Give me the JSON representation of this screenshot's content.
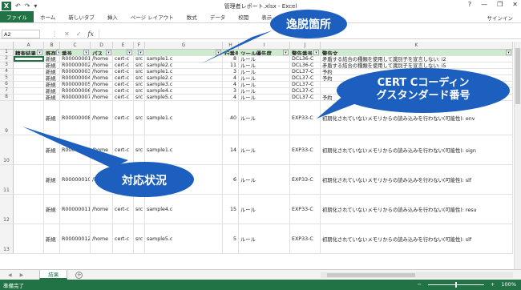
{
  "window": {
    "title": "管理者レポート.xlsx - Excel",
    "quick_access": [
      "↶",
      "↷",
      "▾"
    ],
    "controls": [
      "?",
      "—",
      "❐",
      "✕"
    ]
  },
  "ribbon": {
    "tabs": [
      "ファイル",
      "ホーム",
      "新しいタブ",
      "挿入",
      "ページ レイアウト",
      "数式",
      "データ",
      "校閲",
      "表示",
      "SkyPDF"
    ],
    "signin": "サインイン"
  },
  "formula_bar": {
    "name_box": "A2",
    "icons": [
      "⋮",
      "✕",
      "✓"
    ],
    "fx": "fx",
    "value": ""
  },
  "grid": {
    "columns": [
      "A",
      "B",
      "C",
      "D",
      "E",
      "F",
      "G",
      "H",
      "I",
      "J",
      "K"
    ],
    "headers": [
      "精査結果",
      "既存",
      "番号",
      "パス",
      "",
      "",
      "",
      "行番号",
      "ツール優先度",
      "警告番号",
      "警告文"
    ],
    "rows": [
      {
        "num": "2",
        "cells": [
          "",
          "新規",
          "R00000001",
          "/home",
          "cert-c",
          "src",
          "sample1.c",
          "8",
          "ルール",
          "DCL36-C",
          "矛盾する結合の種類を使用して識別子を宣言しない: i2"
        ]
      },
      {
        "num": "3",
        "cells": [
          "",
          "新規",
          "R00000002",
          "/home",
          "cert-c",
          "src",
          "sample2.c",
          "11",
          "ルール",
          "DCL36-C",
          "矛盾する結合の種類を使用して識別子を宣言しない: i5"
        ]
      },
      {
        "num": "4",
        "cells": [
          "",
          "新規",
          "R00000003",
          "/home",
          "cert-c",
          "src",
          "sample1.c",
          "3",
          "ルール",
          "DCL37-C",
          "予約"
        ]
      },
      {
        "num": "5",
        "cells": [
          "",
          "新規",
          "R00000004",
          "/home",
          "cert-c",
          "src",
          "sample2.c",
          "4",
          "ルール",
          "DCL37-C",
          "予約"
        ]
      },
      {
        "num": "6",
        "cells": [
          "",
          "新規",
          "R00000005",
          "/home",
          "cert-c",
          "src",
          "sample3.c",
          "4",
          "ルール",
          "DCL37-C",
          ""
        ]
      },
      {
        "num": "7",
        "cells": [
          "",
          "新規",
          "R00000006",
          "/home",
          "cert-c",
          "src",
          "sample4.c",
          "3",
          "ルール",
          "DCL37-C",
          ""
        ]
      },
      {
        "num": "8",
        "cells": [
          "",
          "新規",
          "R00000007",
          "/home",
          "cert-c",
          "src",
          "sample5.c",
          "4",
          "ルール",
          "DCL37-C",
          "予約"
        ]
      },
      {
        "num": "9",
        "cells": [
          "",
          "新規",
          "R00000008",
          "/home",
          "cert-c",
          "src",
          "sample1.c",
          "40",
          "ルール",
          "EXP33-C",
          "初期化されていないメモリからの読み込みを行わない(可能性): env"
        ]
      },
      {
        "num": "10",
        "cells": [
          "",
          "新規",
          "R00000009",
          "/home",
          "cert-c",
          "src",
          "sample1.c",
          "14",
          "ルール",
          "EXP33-C",
          "初期化されていないメモリからの読み込みを行わない(可能性): sign"
        ]
      },
      {
        "num": "11",
        "cells": [
          "",
          "新規",
          "R00000010",
          "/home",
          "cert-c",
          "src",
          "sample2.c",
          "6",
          "ルール",
          "EXP33-C",
          "初期化されていないメモリからの読み込みを行わない(可能性): slf"
        ]
      },
      {
        "num": "12",
        "cells": [
          "",
          "新規",
          "R00000011",
          "/home",
          "cert-c",
          "src",
          "sample4.c",
          "15",
          "ルール",
          "EXP33-C",
          "初期化されていないメモリからの読み込みを行わない(可能性): resu"
        ]
      },
      {
        "num": "13",
        "cells": [
          "",
          "新規",
          "R00000012",
          "/home",
          "cert-c",
          "src",
          "sample5.c",
          "5",
          "ルール",
          "EXP33-C",
          "初期化されていないメモリからの読み込みを行わない(可能性): slf"
        ]
      }
    ]
  },
  "sheet": {
    "tab": "結果",
    "nav": [
      "◀",
      "▶"
    ],
    "add": "+"
  },
  "status": {
    "left": "準備完了",
    "zoom": "100%",
    "zoom_minus": "−",
    "zoom_plus": "+"
  },
  "callouts": {
    "deviation": "逸脱箇所",
    "cert_std_line1": "CERT Cコーディン",
    "cert_std_line2": "グスタンダード番号",
    "status": "対応状況"
  },
  "colors": {
    "excel_green": "#217346",
    "header_fill": "#cdeccd",
    "callout_blue": "#1c5fbf"
  }
}
